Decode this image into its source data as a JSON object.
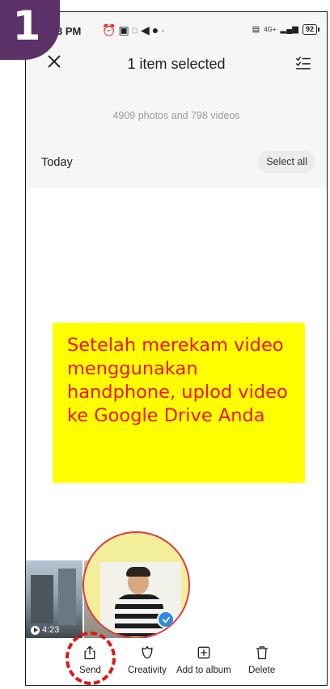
{
  "step": {
    "number": "1",
    "color": "#5b3168"
  },
  "status_bar": {
    "time": "3 PM",
    "icons": [
      "alarm-icon",
      "calendar-icon",
      "whatsapp-icon",
      "telegram-icon",
      "notification-icon"
    ],
    "network": "4G+",
    "battery": "92"
  },
  "top_bar": {
    "close_icon": "close-icon",
    "title": "1 item selected",
    "select_mode_icon": "checklist-icon"
  },
  "gallery": {
    "counts": "4909 photos and 798 videos",
    "section_label": "Today",
    "select_all_label": "Select all",
    "video_duration": "4:23"
  },
  "callout": {
    "text": "Setelah merekam video menggunakan handphone, uplod video ke Google Drive Anda",
    "background": "#ffff00",
    "color": "#ee1414"
  },
  "actions": [
    {
      "label": "Send",
      "icon": "share-icon"
    },
    {
      "label": "Creativity",
      "icon": "creativity-icon"
    },
    {
      "label": "Add to album",
      "icon": "add-to-album-icon"
    },
    {
      "label": "Delete",
      "icon": "trash-icon"
    }
  ],
  "highlight_color": "#e01616"
}
